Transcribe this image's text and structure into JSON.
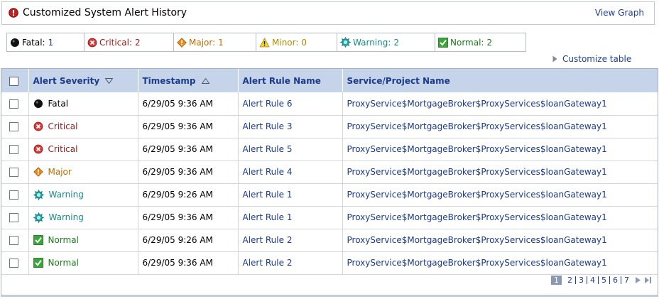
{
  "header": {
    "title": "Customized System Alert History",
    "view_graph": "View Graph"
  },
  "summary": [
    {
      "label": "Fatal:",
      "count": "1",
      "icon": "fatal-icon",
      "color": "#000000"
    },
    {
      "label": "Critical:",
      "count": "2",
      "icon": "critical-icon",
      "color": "#a11c1c"
    },
    {
      "label": "Major:",
      "count": "1",
      "icon": "major-icon",
      "color": "#c06c00"
    },
    {
      "label": "Minor:",
      "count": "0",
      "icon": "minor-icon",
      "color": "#b08a00"
    },
    {
      "label": "Warning:",
      "count": "2",
      "icon": "warning-icon",
      "color": "#178a8a"
    },
    {
      "label": "Normal:",
      "count": "2",
      "icon": "normal-icon",
      "color": "#1b7a1b"
    }
  ],
  "customize_label": "Customize table",
  "table": {
    "columns": [
      "Alert Severity",
      "Timestamp",
      "Alert Rule Name",
      "Service/Project Name"
    ],
    "rows": [
      {
        "severity": "Fatal",
        "timestamp": "6/29/05 9:36 AM",
        "rule": "Alert Rule 6",
        "service": "ProxyService$MortgageBroker$ProxyServices$loanGateway1"
      },
      {
        "severity": "Critical",
        "timestamp": "6/29/05 9:36 AM",
        "rule": "Alert Rule 3",
        "service": "ProxyService$MortgageBroker$ProxyServices$loanGateway1"
      },
      {
        "severity": "Critical",
        "timestamp": "6/29/05 9:36 AM",
        "rule": "Alert Rule 5",
        "service": "ProxyService$MortgageBroker$ProxyServices$loanGateway1"
      },
      {
        "severity": "Major",
        "timestamp": "6/29/05 9:36 AM",
        "rule": "Alert Rule 4",
        "service": "ProxyService$MortgageBroker$ProxyServices$loanGateway1"
      },
      {
        "severity": "Warning",
        "timestamp": "6/29/05 9:26 AM",
        "rule": "Alert Rule 1",
        "service": "ProxyService$MortgageBroker$ProxyServices$loanGateway1"
      },
      {
        "severity": "Warning",
        "timestamp": "6/29/05 9:36 AM",
        "rule": "Alert Rule 1",
        "service": "ProxyService$MortgageBroker$ProxyServices$loanGateway1"
      },
      {
        "severity": "Normal",
        "timestamp": "6/29/05 9:26 AM",
        "rule": "Alert Rule 2",
        "service": "ProxyService$MortgageBroker$ProxyServices$loanGateway1"
      },
      {
        "severity": "Normal",
        "timestamp": "6/29/05 9:36 AM",
        "rule": "Alert Rule 2",
        "service": "ProxyService$MortgageBroker$ProxyServices$loanGateway1"
      }
    ]
  },
  "pagination": {
    "pages": [
      "1",
      "2",
      "3",
      "4",
      "5",
      "6",
      "7"
    ],
    "current": "1"
  }
}
